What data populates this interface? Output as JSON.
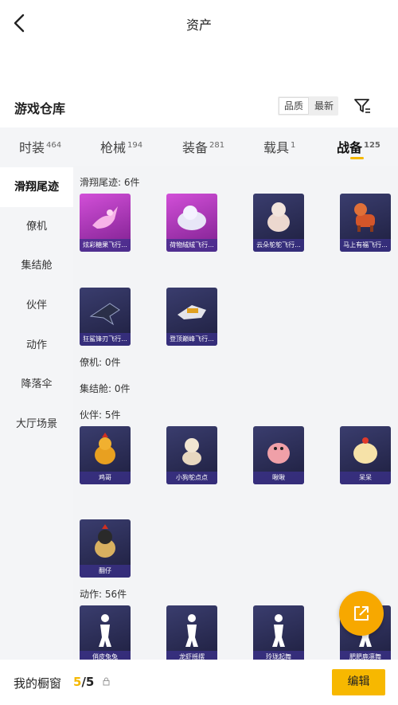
{
  "header": {
    "title": "资产"
  },
  "warehouse": {
    "title": "游戏仓库",
    "sort_options": [
      "品质",
      "最新"
    ]
  },
  "tabs": [
    {
      "label": "时装",
      "count": "464"
    },
    {
      "label": "枪械",
      "count": "194"
    },
    {
      "label": "装备",
      "count": "281"
    },
    {
      "label": "载具",
      "count": "1"
    },
    {
      "label": "战备",
      "count": "125",
      "active": true
    }
  ],
  "sidebar": {
    "items": [
      "滑翔尾迹",
      "僚机",
      "集结舱",
      "伙伴",
      "动作",
      "降落伞",
      "大厅场景"
    ]
  },
  "sections": {
    "glide": "滑翔尾迹: 6件",
    "wingman": "僚机: 0件",
    "pod": "集结舱: 0件",
    "partner": "伙伴: 5件",
    "action": "动作: 56件"
  },
  "items": {
    "glide": [
      "炫彩糖果飞行...",
      "荷物絨絨飞行...",
      "云朵鸵鸵飞行...",
      "马上有福飞行...",
      "狂鲨锋刃飞行...",
      "登顶巅峰飞行..."
    ],
    "partner": [
      "鸡哥",
      "小狗鸵点点",
      "啾啾",
      "呆呆",
      "翻仔"
    ],
    "action": [
      "俏皮兔兔",
      "龙虾摇摆",
      "玲珑起舞",
      "肥肥鹿凛舞"
    ]
  },
  "bottom": {
    "label": "我的橱窗",
    "current": "5",
    "total": "/5",
    "edit": "编辑"
  },
  "colors": {
    "accent": "#f7b800",
    "card_rare": "#7c1f8e",
    "card_common": "#2b2d55"
  },
  "icons": [
    "back-arrow-icon",
    "filter-icon",
    "lock-icon",
    "share-icon"
  ]
}
